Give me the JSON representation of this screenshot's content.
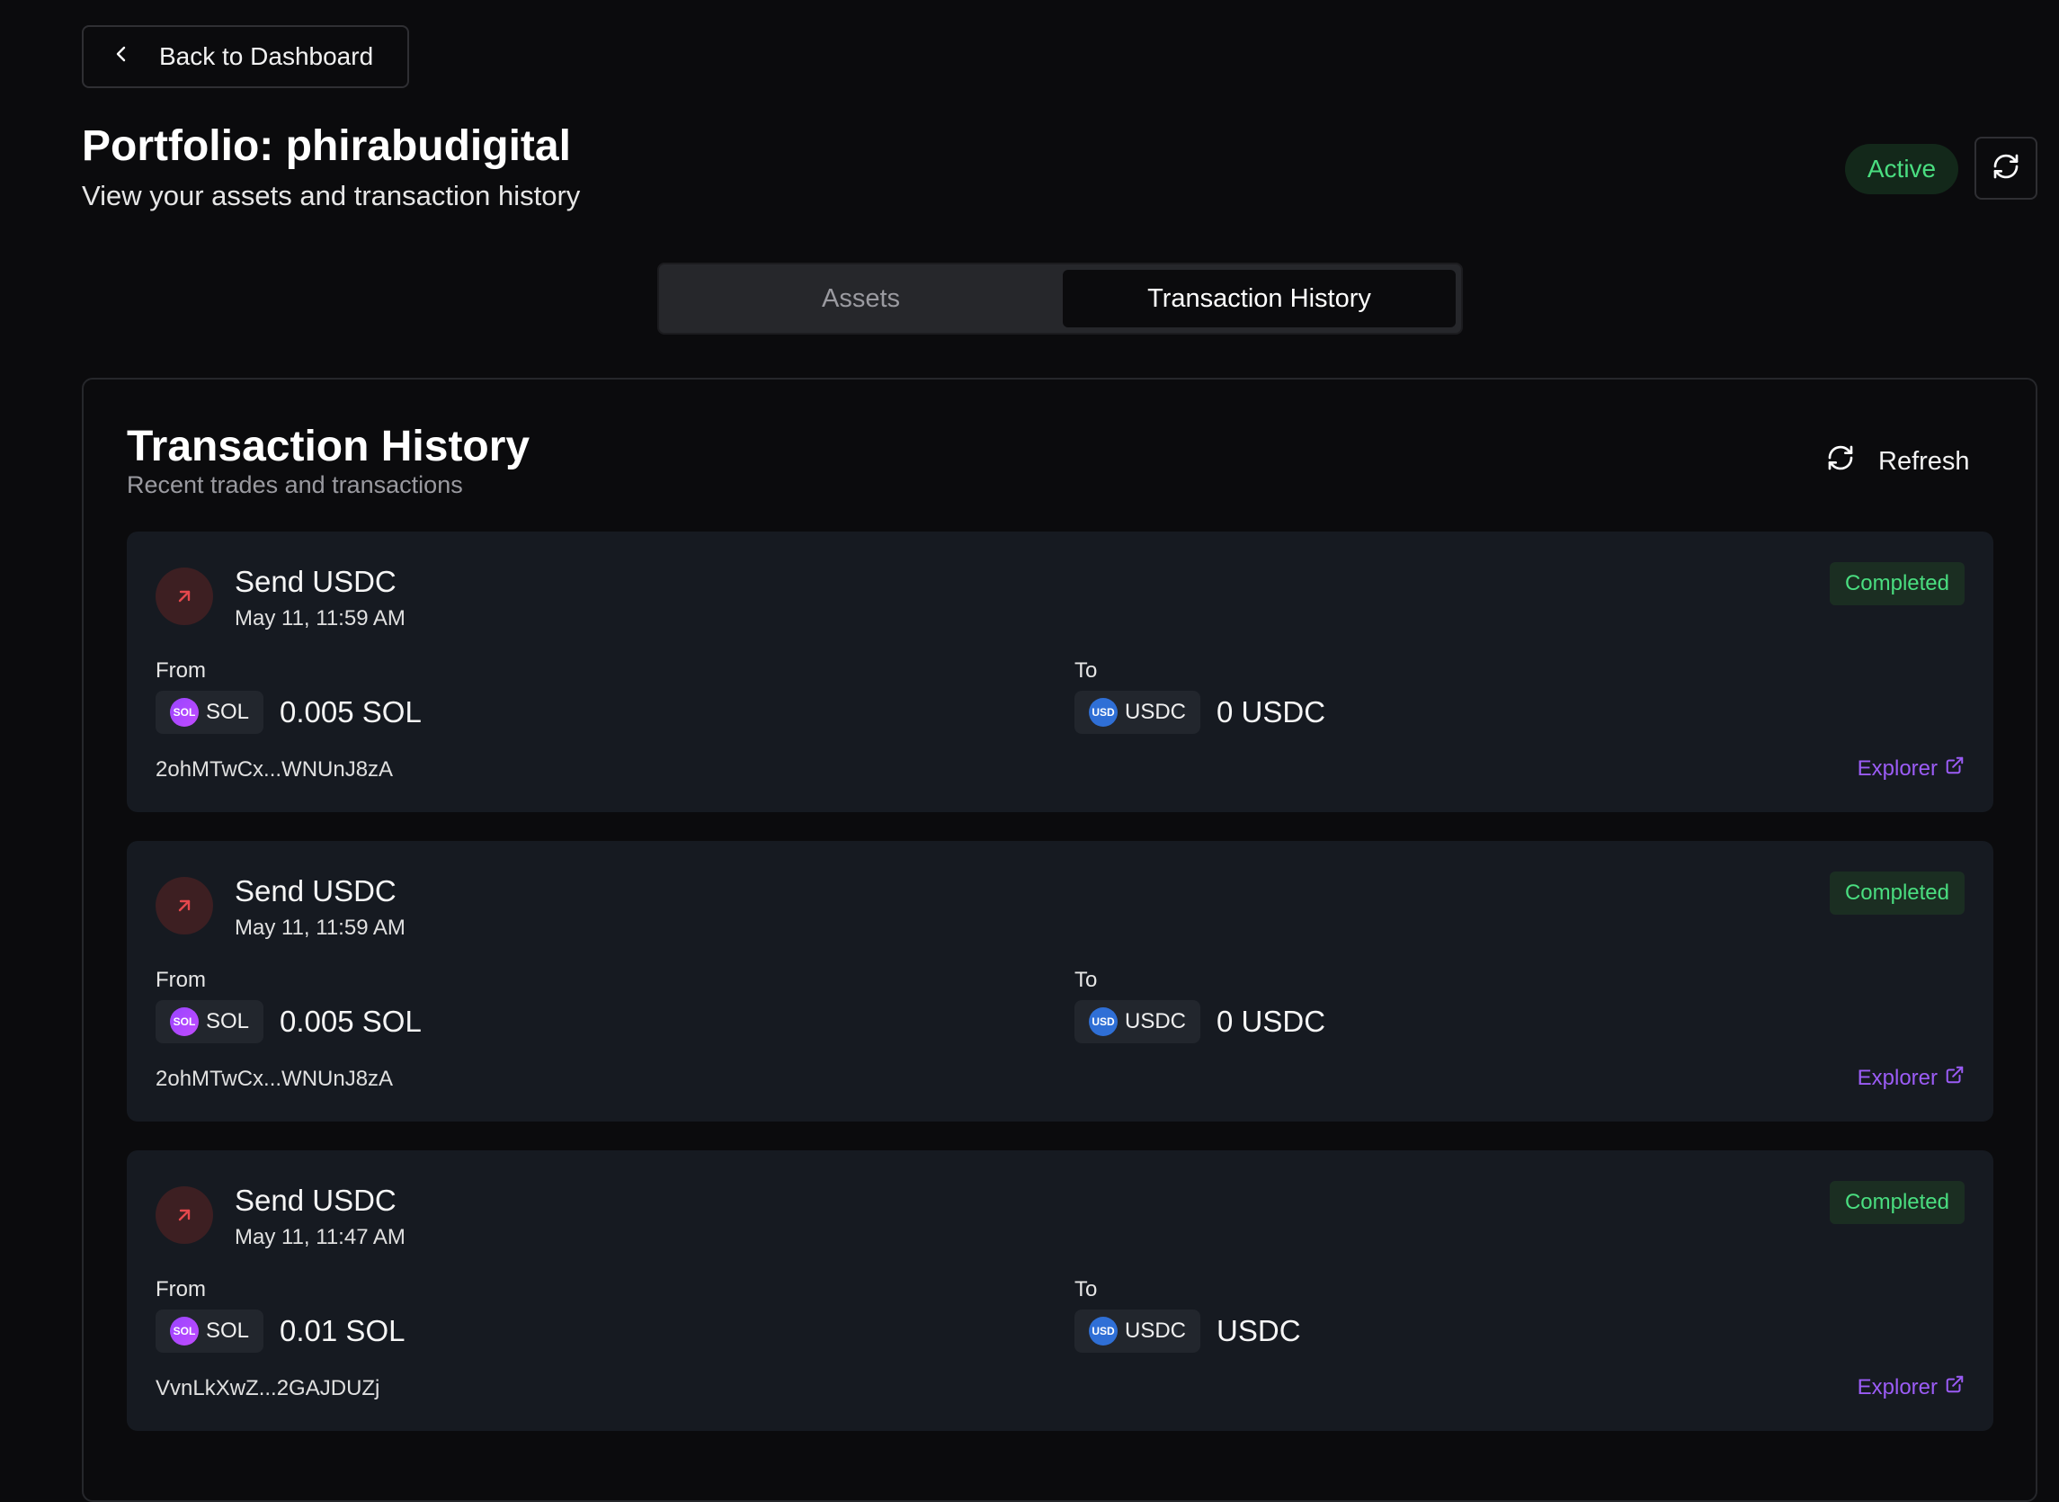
{
  "nav": {
    "back_label": "Back to Dashboard"
  },
  "header": {
    "title": "Portfolio: phirabudigital",
    "subtitle": "View your assets and transaction history",
    "status": "Active"
  },
  "tabs": [
    {
      "label": "Assets",
      "active": false
    },
    {
      "label": "Transaction History",
      "active": true
    }
  ],
  "history": {
    "title": "Transaction History",
    "subtitle": "Recent trades and transactions",
    "refresh_label": "Refresh",
    "transactions": [
      {
        "title": "Send USDC",
        "date": "May 11, 11:59 AM",
        "status": "Completed",
        "from_label": "From",
        "from_coin": "SOL",
        "from_token": "SOL",
        "from_amount": "0.005 SOL",
        "to_label": "To",
        "to_coin": "USD",
        "to_token": "USDC",
        "to_amount": "0 USDC",
        "hash": "2ohMTwCx...WNUnJ8zA",
        "explorer_label": "Explorer"
      },
      {
        "title": "Send USDC",
        "date": "May 11, 11:59 AM",
        "status": "Completed",
        "from_label": "From",
        "from_coin": "SOL",
        "from_token": "SOL",
        "from_amount": "0.005 SOL",
        "to_label": "To",
        "to_coin": "USD",
        "to_token": "USDC",
        "to_amount": "0 USDC",
        "hash": "2ohMTwCx...WNUnJ8zA",
        "explorer_label": "Explorer"
      },
      {
        "title": "Send USDC",
        "date": "May 11, 11:47 AM",
        "status": "Completed",
        "from_label": "From",
        "from_coin": "SOL",
        "from_token": "SOL",
        "from_amount": "0.01 SOL",
        "to_label": "To",
        "to_coin": "USD",
        "to_token": "USDC",
        "to_amount": "USDC",
        "hash": "VvnLkXwZ...2GAJDUZj",
        "explorer_label": "Explorer"
      }
    ]
  },
  "icons": {
    "back": "chevron-left-icon",
    "refresh": "refresh-icon",
    "send": "arrow-up-right-icon",
    "external": "external-link-icon"
  },
  "colors": {
    "background": "#0b0b0d",
    "card": "#161a21",
    "success": "#4ade80",
    "accent": "#9b5cf6",
    "send": "#e5484d"
  }
}
